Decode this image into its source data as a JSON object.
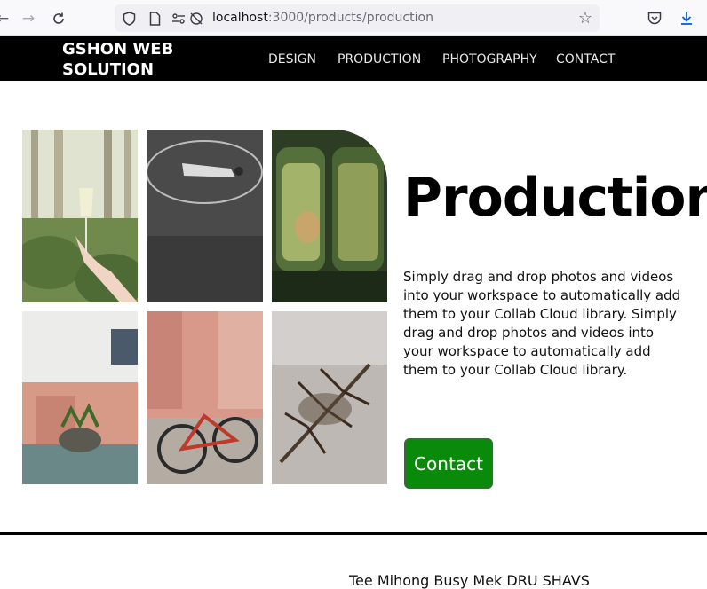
{
  "browser": {
    "url_host": "localhost",
    "url_path": ":3000/products/production",
    "icons": [
      "back-icon",
      "forward-icon",
      "reload-icon",
      "shield-icon",
      "page-icon",
      "permissions-icon",
      "tracking-off-icon",
      "bookmark-star-icon",
      "pocket-icon",
      "download-icon"
    ]
  },
  "site": {
    "brand": "GSHON WEB SOLUTION",
    "menu": [
      "DESIGN",
      "PRODUCTION",
      "PHOTOGRAPHY",
      "CONTACT"
    ]
  },
  "hero": {
    "title": "Production",
    "description": "Simply drag and drop photos and videos into your workspace to automatically add them to your Collab Cloud library. Simply drag and drop photos and videos into your workspace to automatically add them to your Collab Cloud library.",
    "button_label": "Contact",
    "button_color": "#0a8a0a"
  },
  "gallery": {
    "photos": [
      "hand-holding-wine-glass-photo",
      "person-lying-on-court-photo",
      "green-train-interior-photo",
      "pink-building-plant-photo",
      "red-bicycles-photo",
      "pine-branch-snow-photo"
    ]
  },
  "footer": {
    "partial_text": "Tee Mihong Busy Mek DRU SHAVS"
  }
}
